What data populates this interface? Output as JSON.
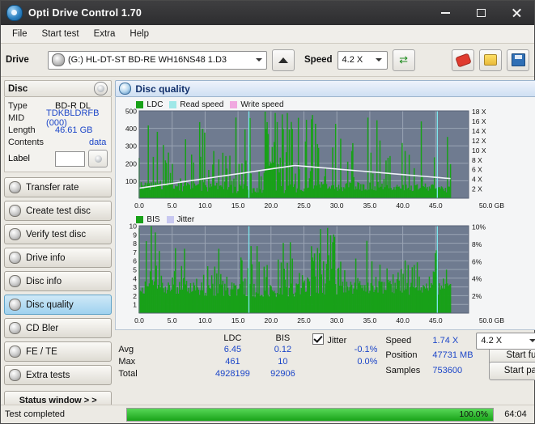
{
  "window": {
    "title": "Opti Drive Control 1.70",
    "minimize": "–",
    "maximize": "□",
    "close": "✕"
  },
  "menu": [
    "File",
    "Start test",
    "Extra",
    "Help"
  ],
  "drivebar": {
    "drive_label": "Drive",
    "drive_value": "(G:)  HL-DT-ST BD-RE  WH16NS48 1.D3",
    "eject_icon": "eject-icon",
    "speed_label": "Speed",
    "speed_value": "4.2 X",
    "refresh_icon": "refresh-icon",
    "eraser_icon": "eraser-icon",
    "key_icon": "key-icon",
    "save_icon": "save-icon"
  },
  "disc_panel": {
    "title": "Disc",
    "rows": [
      {
        "key": "Type",
        "value": "BD-R DL"
      },
      {
        "key": "MID",
        "value": "TDKBLDRFB (000)"
      },
      {
        "key": "Length",
        "value": "46.61 GB"
      },
      {
        "key": "Contents",
        "value": "data"
      }
    ],
    "label_key": "Label",
    "label_value": ""
  },
  "nav": [
    {
      "label": "Transfer rate",
      "active": false
    },
    {
      "label": "Create test disc",
      "active": false
    },
    {
      "label": "Verify test disc",
      "active": false
    },
    {
      "label": "Drive info",
      "active": false
    },
    {
      "label": "Disc info",
      "active": false
    },
    {
      "label": "Disc quality",
      "active": true
    },
    {
      "label": "CD Bler",
      "active": false
    },
    {
      "label": "FE / TE",
      "active": false
    },
    {
      "label": "Extra tests",
      "active": false
    }
  ],
  "status_window_button": "Status window > >",
  "main": {
    "title": "Disc quality"
  },
  "chart_data": [
    {
      "type": "line",
      "title": "LDC / Read speed / Write speed",
      "legend": [
        {
          "label": "LDC",
          "color": "#18a118"
        },
        {
          "label": "Read speed",
          "color": "#9fe8e8"
        },
        {
          "label": "Write speed",
          "color": "#f0a8e0"
        }
      ],
      "legend_position": "top-left",
      "xlabel": "50.0 GB",
      "x": [
        0.0,
        5.0,
        10.0,
        15.0,
        20.0,
        25.0,
        30.0,
        35.0,
        40.0,
        45.0,
        50.0
      ],
      "xticklabels": [
        "0.0",
        "5.0",
        "10.0",
        "15.0",
        "20.0",
        "25.0",
        "30.0",
        "35.0",
        "40.0",
        "45.0",
        "50.0 GB"
      ],
      "ylim": [
        0,
        500
      ],
      "yticklabels": [
        "100",
        "200",
        "300",
        "400",
        "500"
      ],
      "y2ticklabels": [
        "2 X",
        "4 X",
        "6 X",
        "8 X",
        "10 X",
        "12 X",
        "14 X",
        "16 X",
        "18 X"
      ],
      "series": [
        {
          "name": "LDC",
          "color": "#18a118",
          "note": "dense green spikes, base ~40-90, peaks to ~500 across the span"
        },
        {
          "name": "Read speed",
          "color": "#e8f0f8",
          "note": "rises from ~2X at 0 GB to ~5X near 25 GB then declines to ~3X at 47 GB"
        }
      ],
      "grid": true
    },
    {
      "type": "line",
      "title": "BIS / Jitter",
      "legend": [
        {
          "label": "BIS",
          "color": "#18a118"
        },
        {
          "label": "Jitter",
          "color": "#c8c8f0"
        }
      ],
      "legend_position": "top-left",
      "xlabel": "50.0 GB",
      "xticklabels": [
        "0.0",
        "5.0",
        "10.0",
        "15.0",
        "20.0",
        "25.0",
        "30.0",
        "35.0",
        "40.0",
        "45.0",
        "50.0 GB"
      ],
      "ylim": [
        0,
        10
      ],
      "yticklabels": [
        "1",
        "2",
        "3",
        "4",
        "5",
        "6",
        "7",
        "8",
        "9",
        "10"
      ],
      "y2ticklabels": [
        "2%",
        "4%",
        "6%",
        "8%",
        "10%"
      ],
      "series": [
        {
          "name": "BIS",
          "color": "#18a118",
          "note": "dense green spikes, base ~2-3, frequent peaks to 9-10"
        }
      ],
      "grid": true
    }
  ],
  "stats": {
    "col_headers": [
      "LDC",
      "BIS"
    ],
    "rows": [
      {
        "label": "Avg",
        "ldc": "6.45",
        "bis": "0.12"
      },
      {
        "label": "Max",
        "ldc": "461",
        "bis": "10"
      },
      {
        "label": "Total",
        "ldc": "4928199",
        "bis": "92906"
      }
    ],
    "jitter_label": "Jitter",
    "jitter_checked": true,
    "jitter_avg": "-0.1%",
    "jitter_max": "0.0%",
    "speed_label": "Speed",
    "speed_value": "1.74 X",
    "speed_combo": "4.2 X",
    "position_label": "Position",
    "position_value": "47731 MB",
    "samples_label": "Samples",
    "samples_value": "753600",
    "start_full": "Start full",
    "start_part": "Start part"
  },
  "statusbar": {
    "text": "Test completed",
    "progress_percent": "100.0%",
    "progress_value": 100,
    "elapsed": "64:04"
  }
}
